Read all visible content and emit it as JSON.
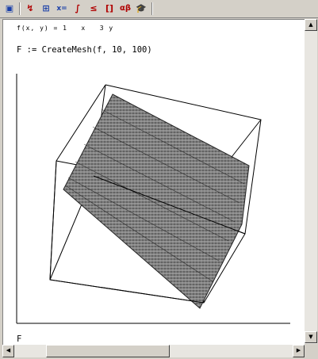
{
  "toolbar": {
    "items": [
      {
        "name": "save-icon",
        "glyph": "▣"
      },
      {
        "name": "graph-icon",
        "glyph": "↯"
      },
      {
        "name": "matrix-icon",
        "glyph": "⊞"
      },
      {
        "name": "evaluate-icon",
        "glyph": "x="
      },
      {
        "name": "calculus-icon",
        "glyph": "∫"
      },
      {
        "name": "boolean-icon",
        "glyph": "≤"
      },
      {
        "name": "programming-icon",
        "glyph": "[]"
      },
      {
        "name": "greek-icon",
        "glyph": "αβ"
      },
      {
        "name": "symbolic-icon",
        "glyph": "🎓"
      }
    ]
  },
  "worksheet": {
    "lines": [
      "f(x, y) = 1   x   3 y",
      "F := CreateMesh(f, 10, 100)",
      "F"
    ]
  },
  "scrollbars": {
    "up_arrow": "▲",
    "down_arrow": "▼",
    "left_arrow": "◀",
    "right_arrow": "▶"
  }
}
